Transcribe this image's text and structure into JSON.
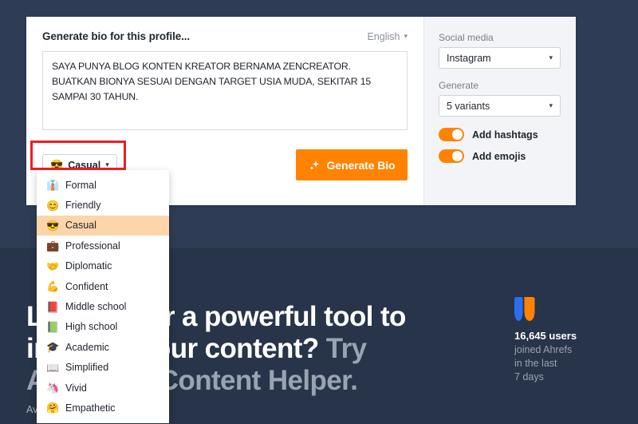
{
  "card": {
    "title": "Generate bio for this profile...",
    "language": "English",
    "prompt_value": "SAYA PUNYA BLOG KONTEN KREATOR BERNAMA ZENCREATOR. BUATKAN BIONYA SESUAI DENGAN TARGET USIA MUDA, SEKITAR 15 SAMPAI 30 TAHUN.",
    "prompt_placeholder": "Generate bio for this profile...",
    "tone_button": {
      "emoji": "😎",
      "label": "Casual"
    },
    "generate_button": "Generate Bio"
  },
  "settings": {
    "social_media_label": "Social media",
    "social_media_value": "Instagram",
    "generate_label": "Generate",
    "generate_value": "5 variants",
    "toggles": [
      {
        "label": "Add hashtags",
        "state": "on"
      },
      {
        "label": "Add emojis",
        "state": "on"
      }
    ]
  },
  "tone_menu": {
    "items": [
      {
        "emoji": "👔",
        "label": "Formal",
        "selected": false
      },
      {
        "emoji": "😊",
        "label": "Friendly",
        "selected": false
      },
      {
        "emoji": "😎",
        "label": "Casual",
        "selected": true
      },
      {
        "emoji": "💼",
        "label": "Professional",
        "selected": false
      },
      {
        "emoji": "🤝",
        "label": "Diplomatic",
        "selected": false
      },
      {
        "emoji": "💪",
        "label": "Confident",
        "selected": false
      },
      {
        "emoji": "📕",
        "label": "Middle school",
        "selected": false
      },
      {
        "emoji": "📗",
        "label": "High school",
        "selected": false
      },
      {
        "emoji": "🎓",
        "label": "Academic",
        "selected": false
      },
      {
        "emoji": "📖",
        "label": "Simplified",
        "selected": false
      },
      {
        "emoji": "🦄",
        "label": "Vivid",
        "selected": false
      },
      {
        "emoji": "🤗",
        "label": "Empathetic",
        "selected": false
      }
    ]
  },
  "hero": {
    "line1": "Looking for a powerful tool to",
    "line2_white": "improve your content? ",
    "line2_muted": "Try",
    "line3_muted": "Ahrefs' AI Content Helper.",
    "subtext": "Available for free while in beta."
  },
  "stats": {
    "value": "16,645 users",
    "line2": "joined Ahrefs",
    "line3": "in the last",
    "line4": "7 days"
  },
  "colors": {
    "accent_orange": "#ff8200",
    "navy_upper": "#2e3c56",
    "navy_lower": "#273449",
    "highlight_red": "#ee1c24",
    "menu_selected": "#fcd5ab",
    "logo_blue": "#2b6ef0",
    "logo_orange": "#ff8200"
  }
}
